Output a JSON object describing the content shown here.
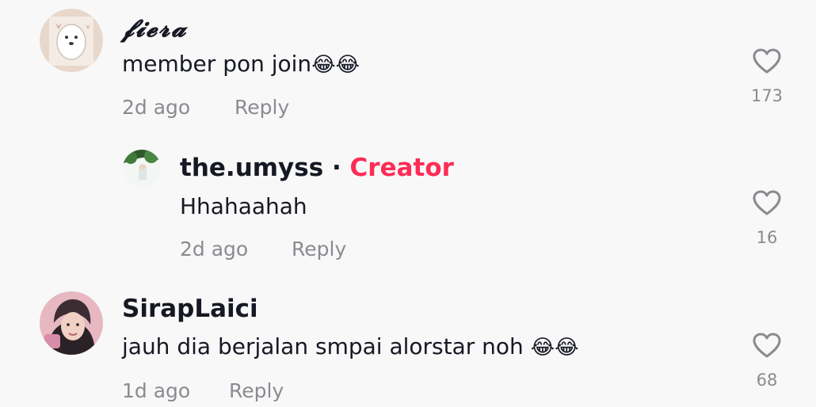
{
  "comments": [
    {
      "username": "𝓯𝓲𝓮𝓻𝓪",
      "text": "member pon join",
      "emoji": "😂😂",
      "time": "2d ago",
      "reply_label": "Reply",
      "likes": "173"
    },
    {
      "username": "the.umyss",
      "separator": "·",
      "badge": "Creator",
      "text": "Hhahaahah",
      "time": "2d ago",
      "reply_label": "Reply",
      "likes": "16"
    },
    {
      "username": "SirapLaici",
      "text": "jauh dia berjalan smpai alorstar noh ",
      "emoji": "😂😂",
      "time": "1d ago",
      "reply_label": "Reply",
      "likes": "68"
    }
  ],
  "colors": {
    "background": "#f8f8f8",
    "text": "#161823",
    "muted": "#8a8b91",
    "creator_badge": "#fe2c55"
  },
  "icons": {
    "like": "heart-outline-icon"
  }
}
